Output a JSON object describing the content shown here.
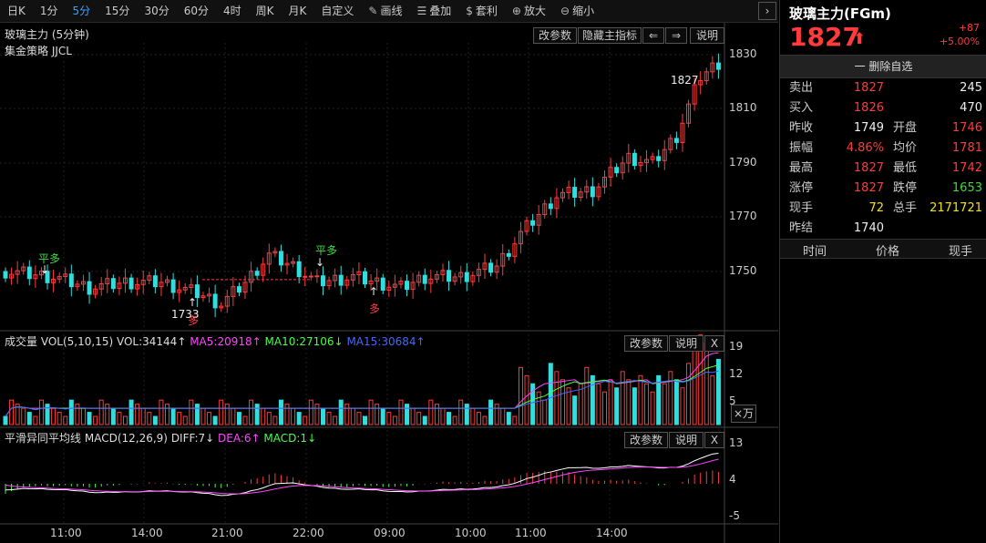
{
  "toolbar": {
    "periods": [
      "日K",
      "1分",
      "5分",
      "15分",
      "30分",
      "60分",
      "4时",
      "周K",
      "月K",
      "自定义"
    ],
    "active_period": "5分",
    "tools": [
      {
        "icon": "pencil-icon",
        "label": "画线"
      },
      {
        "icon": "layers-icon",
        "label": "叠加"
      },
      {
        "icon": "money-bag-icon",
        "label": "套利"
      },
      {
        "icon": "zoom-in-icon",
        "label": "放大"
      },
      {
        "icon": "zoom-out-icon",
        "label": "缩小"
      }
    ],
    "next": "›"
  },
  "main_chart": {
    "title": "玻璃主力 (5分钟)",
    "strategy": "集金策略 JJCL",
    "buttons": {
      "edit": "改参数",
      "hide": "隐藏主指标",
      "left": "⇐",
      "right": "⇒",
      "help": "说明"
    },
    "price_ticks": [
      "1830",
      "1810",
      "1790",
      "1770",
      "1750"
    ],
    "last_price_label": "1827",
    "low_label": "1733",
    "signals": [
      {
        "text": "平多",
        "arrow": "↓",
        "color": "#3ddc3d"
      },
      {
        "text": "平多",
        "arrow": "↓",
        "color": "#3ddc3d"
      },
      {
        "text": "多",
        "arrow": "↑",
        "color": "#ff3b3b"
      },
      {
        "text": "多",
        "arrow": "↑",
        "color": "#ff3b3b"
      }
    ]
  },
  "volume_chart": {
    "name": "成交量",
    "params": "VOL(5,10,15)",
    "vol": "VOL:34144↑",
    "ma5": "MA5:20918↑",
    "ma10": "MA10:27106↓",
    "ma15": "MA15:30684↑",
    "buttons": {
      "edit": "改参数",
      "help": "说明",
      "close": "X"
    },
    "ticks": [
      "19",
      "12",
      "5"
    ],
    "unit": "×万"
  },
  "macd_chart": {
    "name": "平滑异同平均线",
    "params": "MACD(12,26,9)",
    "diff": "DIFF:7↓",
    "dea": "DEA:6↑",
    "macd": "MACD:1↓",
    "buttons": {
      "edit": "改参数",
      "help": "说明",
      "close": "X"
    },
    "ticks": [
      "13",
      "4",
      "-5"
    ]
  },
  "time_axis": [
    "11:00",
    "14:00",
    "21:00",
    "22:00",
    "09:00",
    "10:00",
    "11:00",
    "14:00"
  ],
  "colors": {
    "up": "#ff3b3b",
    "down": "#33dddd",
    "ma5": "#ff44ff",
    "ma10": "#44ff44",
    "ma15": "#4466ff",
    "diff": "#ffffff",
    "dea": "#ff44ff"
  },
  "quote": {
    "name": "玻璃主力(FGm)",
    "price": "1827",
    "arrow": "⬆",
    "change": "+87",
    "change_pct": "+5.00%",
    "delete_btn": "一 删除自选",
    "rows": [
      {
        "l1": "卖出",
        "v1": "1827",
        "c1": "red",
        "l2": "",
        "v2": "245",
        "c2": "white"
      },
      {
        "l1": "买入",
        "v1": "1826",
        "c1": "red",
        "l2": "",
        "v2": "470",
        "c2": "white"
      },
      {
        "l1": "昨收",
        "v1": "1749",
        "c1": "white",
        "l2": "开盘",
        "v2": "1746",
        "c2": "red"
      },
      {
        "l1": "振幅",
        "v1": "4.86%",
        "c1": "red",
        "l2": "均价",
        "v2": "1781",
        "c2": "red"
      },
      {
        "l1": "最高",
        "v1": "1827",
        "c1": "red",
        "l2": "最低",
        "v2": "1742",
        "c2": "red"
      },
      {
        "l1": "涨停",
        "v1": "1827",
        "c1": "red",
        "l2": "跌停",
        "v2": "1653",
        "c2": "green"
      },
      {
        "l1": "现手",
        "v1": "72",
        "c1": "yellow",
        "l2": "总手",
        "v2": "2171721",
        "c2": "yellow"
      },
      {
        "l1": "昨结",
        "v1": "1740",
        "c1": "white",
        "l2": "",
        "v2": "",
        "c2": "white"
      }
    ],
    "trade_headers": [
      "时间",
      "价格",
      "现手"
    ]
  }
}
